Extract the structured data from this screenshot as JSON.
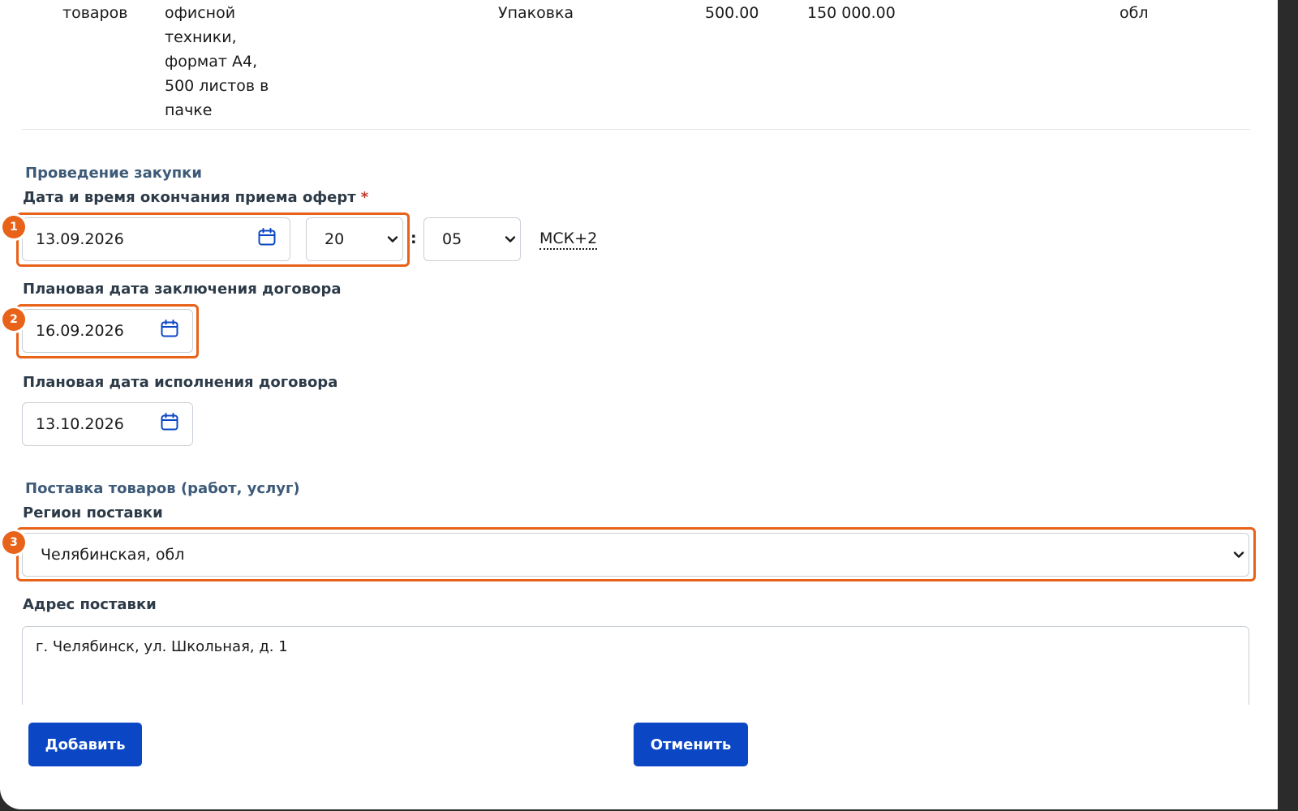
{
  "table_row": {
    "type": "товаров",
    "description_lines": [
      "офисной",
      "техники,",
      "формат А4,",
      "500 листов в",
      "пачке"
    ],
    "unit": "Упаковка",
    "price": "500.00",
    "sum": "150 000.00",
    "region_tail": "обл"
  },
  "procurement": {
    "section_title": "Проведение закупки",
    "offers_deadline_label": "Дата и время окончания приема оферт",
    "required_mark": "*",
    "offers_deadline_date": "13.09.2026",
    "offers_deadline_hour": "20",
    "offers_deadline_minute": "05",
    "time_separator": ":",
    "timezone": "МСК+2",
    "contract_sign_label": "Плановая дата заключения договора",
    "contract_sign_date": "16.09.2026",
    "contract_exec_label": "Плановая дата исполнения договора",
    "contract_exec_date": "13.10.2026"
  },
  "delivery": {
    "section_title": "Поставка товаров (работ, услуг)",
    "region_label": "Регион поставки",
    "region_value": "Челябинская, обл",
    "address_label": "Адрес поставки",
    "address_value": "г. Челябинск, ул. Школьная, д. 1"
  },
  "annotations": [
    "1",
    "2",
    "3"
  ],
  "buttons": {
    "add": "Добавить",
    "cancel": "Отменить"
  },
  "colors": {
    "accent": "#0b47c4",
    "highlight": "#e8621a",
    "section_title": "#3d5a78",
    "required": "#c0392b"
  },
  "icons": [
    "calendar-icon",
    "chevron-down-icon"
  ]
}
